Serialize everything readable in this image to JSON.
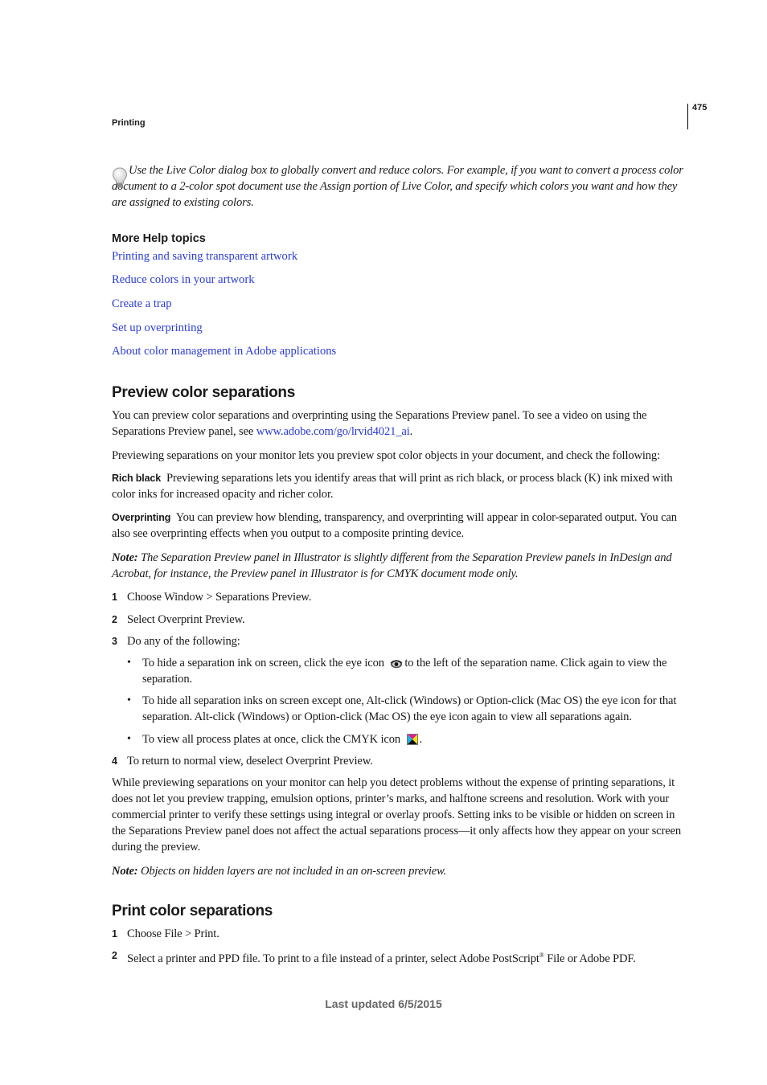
{
  "header": {
    "running_head": "Printing",
    "page_number": "475"
  },
  "tip": {
    "icon": "lightbulb-icon",
    "text": "Use the Live Color dialog box to globally convert and reduce colors. For example, if you want to convert a process color document to a 2-color spot document use the Assign portion of Live Color, and specify which colors you want and how they are assigned to existing colors."
  },
  "more_help": {
    "title": "More Help topics",
    "links": [
      "Printing and saving transparent artwork",
      "Reduce colors in your artwork",
      "Create a trap",
      "Set up overprinting",
      "About color management in Adobe applications"
    ]
  },
  "preview_section": {
    "heading": "Preview color separations",
    "intro_before_link": "You can preview color separations and overprinting using the Separations Preview panel. To see a video on using the Separations Preview panel, see ",
    "intro_link": "www.adobe.com/go/lrvid4021_ai",
    "intro_after_link": ".",
    "check_text": "Previewing separations on your monitor lets you preview spot color objects in your document, and check the following:",
    "terms": [
      {
        "term": "Rich black",
        "text": "Previewing separations lets you identify areas that will print as rich black, or process black (K) ink mixed with color inks for increased opacity and richer color."
      },
      {
        "term": "Overprinting",
        "text": "You can preview how blending, transparency, and overprinting will appear in color-separated output. You can also see overprinting effects when you output to a composite printing device."
      }
    ],
    "note1_label": "Note:",
    "note1_text": " The Separation Preview panel in Illustrator is slightly different from the Separation Preview panels in InDesign and Acrobat, for instance, the Preview panel in Illustrator is for CMYK document mode only.",
    "steps": [
      {
        "num": "1",
        "text": "Choose Window > Separations Preview."
      },
      {
        "num": "2",
        "text": "Select Overprint Preview."
      },
      {
        "num": "3",
        "text": "Do any of the following:"
      },
      {
        "num": "4",
        "text": "To return to normal view, deselect Overprint Preview."
      }
    ],
    "bullets": [
      {
        "before_icon": "To hide a separation ink on screen, click the eye icon ",
        "icon": "eye-icon",
        "after_icon": "to the left of the separation name. Click again to view the separation."
      },
      {
        "text": "To hide all separation inks on screen except one, Alt-click (Windows) or Option-click (Mac OS) the eye icon for that separation. Alt-click (Windows) or Option-click (Mac OS) the eye icon again to view all separations again."
      },
      {
        "before_icon": "To view all process plates at once, click the CMYK icon ",
        "icon": "cmyk-icon",
        "after_icon": "."
      }
    ],
    "closing_paragraph": "While previewing separations on your monitor can help you detect problems without the expense of printing separations, it does not let you preview trapping, emulsion options, printer’s marks, and halftone screens and resolution. Work with your commercial printer to verify these settings using integral or overlay proofs. Setting inks to be visible or hidden on screen in the Separations Preview panel does not affect the actual separations process—it only affects how they appear on your screen during the preview.",
    "note2_label": "Note:",
    "note2_text": " Objects on hidden layers are not included in an on-screen preview."
  },
  "print_section": {
    "heading": "Print color separations",
    "steps": [
      {
        "num": "1",
        "text": "Choose File > Print."
      },
      {
        "num": "2",
        "text_before_sup": "Select a printer and PPD file. To print to a file instead of a printer, select Adobe PostScript",
        "sup": "®",
        "text_after_sup": " File or Adobe PDF."
      }
    ]
  },
  "footer": {
    "last_updated": "Last updated 6/5/2015"
  },
  "colors": {
    "link": "#2b3bd6",
    "footer_text": "#666666",
    "body_text": "#1a1a1a"
  }
}
